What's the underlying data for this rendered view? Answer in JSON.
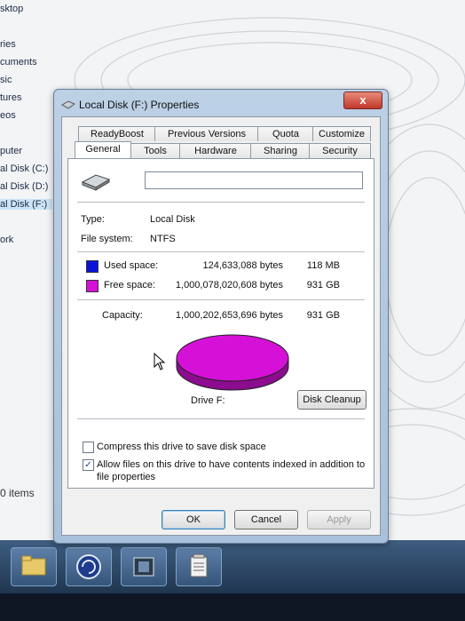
{
  "explorer": {
    "nav_items": [
      "sktop",
      "ries",
      "cuments",
      "sic",
      "tures",
      "eos",
      "puter",
      "al Disk (C:)",
      "al Disk (D:)",
      "al Disk (F:)",
      "ork"
    ],
    "items_count": "0 items"
  },
  "dialog": {
    "title": "Local Disk (F:) Properties",
    "close_icon": "close-x-icon",
    "close_label": "x",
    "tabs_top": [
      "ReadyBoost",
      "Previous Versions",
      "Quota",
      "Customize"
    ],
    "tabs_bottom": [
      "General",
      "Tools",
      "Hardware",
      "Sharing",
      "Security"
    ],
    "active_tab": "General",
    "name_value": "",
    "type_label": "Type:",
    "type_value": "Local Disk",
    "fs_label": "File system:",
    "fs_value": "NTFS",
    "used": {
      "label": "Used space:",
      "bytes": "124,633,088 bytes",
      "size": "118 MB",
      "color": "#0a14d8"
    },
    "free": {
      "label": "Free space:",
      "bytes": "1,000,078,020,608 bytes",
      "size": "931 GB",
      "color": "#d511d8"
    },
    "capacity": {
      "label": "Capacity:",
      "bytes": "1,000,202,653,696 bytes",
      "size": "931 GB"
    },
    "pie": {
      "used_fraction": 0.0001,
      "color_free": "#d511d8",
      "color_used": "#0a14d8"
    },
    "drive_label": "Drive F:",
    "cleanup_label": "Disk Cleanup",
    "compress_label": "Compress this drive to save disk space",
    "compress_checked": false,
    "index_label_line1": "Allow files on this drive to have contents indexed in addition to",
    "index_label_line2": "file properties",
    "index_checked": true,
    "check_glyph": "✓",
    "ok_label": "OK",
    "cancel_label": "Cancel",
    "apply_label": "Apply"
  }
}
